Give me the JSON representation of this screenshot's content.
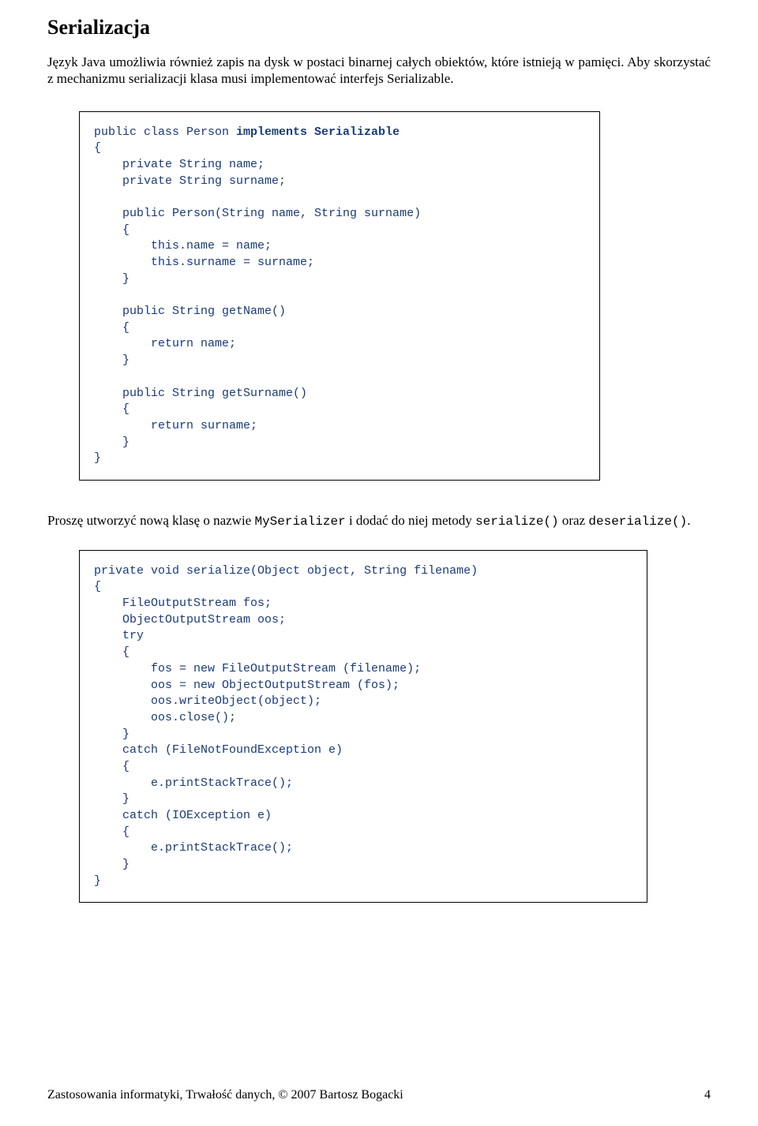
{
  "heading": "Serializacja",
  "intro": "Język Java umożliwia również zapis na dysk w postaci binarnej całych obiektów, które istnieją w pamięci. Aby skorzystać z mechanizmu serializacji klasa musi implementować interfejs Serializable.",
  "code1": {
    "l01": "public class Person ",
    "l01b": "implements Serializable",
    "l02": "{",
    "l03": "    private String name;",
    "l04": "    private String surname;",
    "l05": "",
    "l06": "    public Person(String name, String surname)",
    "l07": "    {",
    "l08": "        this.name = name;",
    "l09": "        this.surname = surname;",
    "l10": "    }",
    "l11": "",
    "l12": "    public String getName()",
    "l13": "    {",
    "l14": "        return name;",
    "l15": "    }",
    "l16": "",
    "l17": "    public String getSurname()",
    "l18": "    {",
    "l19": "        return surname;",
    "l20": "    }",
    "l21": "}"
  },
  "mid": {
    "part1": "Proszę utworzyć nową klasę o nazwie ",
    "c1": "MySerializer",
    "part2": " i dodać do niej metody ",
    "c2": "serialize()",
    "part3": " oraz ",
    "c3": "deserialize()",
    "part4": "."
  },
  "code2": {
    "l01": "private void serialize(Object object, String filename)",
    "l02": "{",
    "l03": "    FileOutputStream fos;",
    "l04": "    ObjectOutputStream oos;",
    "l05": "    try",
    "l06": "    {",
    "l07": "        fos = new FileOutputStream (filename);",
    "l08": "        oos = new ObjectOutputStream (fos);",
    "l09": "        oos.writeObject(object);",
    "l10": "        oos.close();",
    "l11": "    }",
    "l12": "    catch (FileNotFoundException e)",
    "l13": "    {",
    "l14": "        e.printStackTrace();",
    "l15": "    }",
    "l16": "    catch (IOException e)",
    "l17": "    {",
    "l18": "        e.printStackTrace();",
    "l19": "    }",
    "l20": "}"
  },
  "footer": {
    "text": "Zastosowania informatyki, Trwałość danych, © 2007 Bartosz Bogacki",
    "page": "4"
  }
}
